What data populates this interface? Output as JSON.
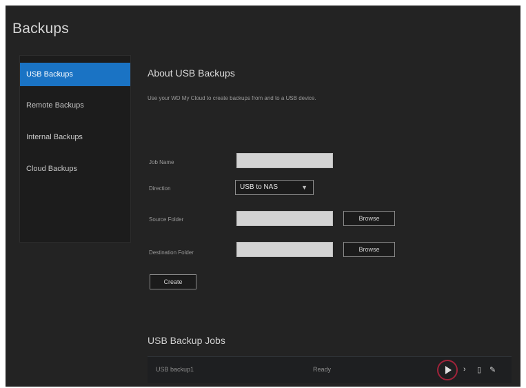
{
  "page": {
    "title": "Backups"
  },
  "sidebar": {
    "items": [
      {
        "label": "USB Backups",
        "active": true
      },
      {
        "label": "Remote Backups",
        "active": false
      },
      {
        "label": "Internal Backups",
        "active": false
      },
      {
        "label": "Cloud Backups",
        "active": false
      }
    ]
  },
  "about": {
    "title": "About USB Backups",
    "description": "Use your WD My Cloud to create backups from and to a USB device."
  },
  "form": {
    "job_name_label": "Job Name",
    "job_name_value": "",
    "direction_label": "Direction",
    "direction_value": "USB to NAS",
    "source_label": "Source Folder",
    "source_value": "",
    "destination_label": "Destination Folder",
    "destination_value": "",
    "browse_label": "Browse",
    "create_label": "Create"
  },
  "jobs": {
    "title": "USB Backup Jobs",
    "rows": [
      {
        "name": "USB backup1",
        "status": "Ready"
      }
    ]
  },
  "icons": {
    "start": "play-icon",
    "details": "details-icon",
    "delete": "delete-icon",
    "edit": "edit-icon"
  },
  "colors": {
    "background": "#232323",
    "sidebar_active": "#1a73c4",
    "highlight_ring": "#a0233a"
  }
}
